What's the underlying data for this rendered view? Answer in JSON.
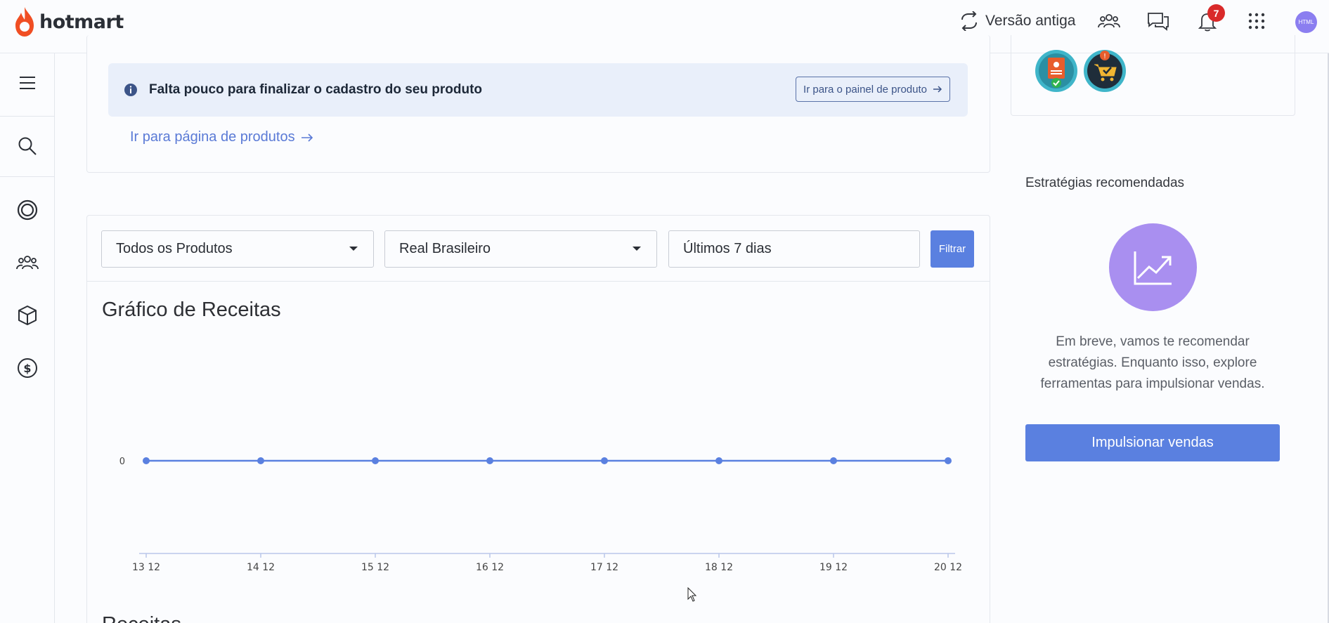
{
  "header": {
    "brand": "hotmart",
    "versao_antiga": "Versão antiga",
    "notifications_count": "7",
    "avatar_initials": "HTML",
    "icons": [
      "community-icon",
      "chat-icon",
      "bell-icon",
      "apps-grid-icon"
    ]
  },
  "sidebar": {
    "items": [
      "menu-icon",
      "search-icon",
      "target-icon",
      "users-icon",
      "box-icon",
      "dollar-icon"
    ]
  },
  "alert": {
    "text": "Falta pouco para finalizar o cadastro do seu produto",
    "button": "Ir para o painel de produto",
    "link": "Ir para página de produtos"
  },
  "filters": {
    "product": "Todos os Produtos",
    "currency": "Real Brasileiro",
    "period": "Últimos 7 dias",
    "submit": "Filtrar"
  },
  "chart_data": {
    "type": "line",
    "title": "Gráfico de Receitas",
    "categories": [
      "13 12",
      "14 12",
      "15 12",
      "16 12",
      "17 12",
      "18 12",
      "19 12",
      "20 12"
    ],
    "values": [
      0,
      0,
      0,
      0,
      0,
      0,
      0,
      0
    ],
    "y_tick_labels": [
      "0"
    ],
    "xlabel": "",
    "ylabel": "",
    "grid": false,
    "color": "#5a80e0"
  },
  "next_section_title": "Receitas",
  "strategies": {
    "title": "Estratégias recomendadas",
    "text": "Em breve, vamos te recomendar estratégias. Enquanto isso, explore ferramentas para impulsionar vendas.",
    "button": "Impulsionar vendas"
  },
  "colors": {
    "accent": "#5a80e0",
    "brand": "#f04e23",
    "alert_bg": "#e9effa",
    "badge": "#d92a2a"
  }
}
